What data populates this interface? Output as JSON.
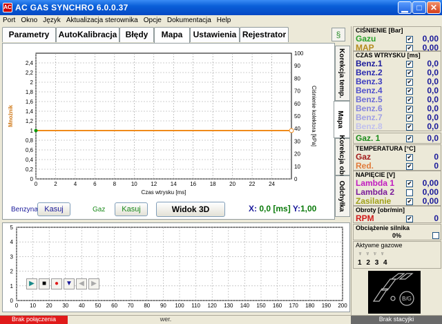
{
  "window": {
    "title": "AC GAS SYNCHRO  6.0.0.37"
  },
  "menu": [
    "Port",
    "Okno",
    "Język",
    "Aktualizacja sterownika",
    "Opcje",
    "Dokumentacja",
    "Help"
  ],
  "tabs": [
    "Parametry",
    "AutoKalibracja",
    "Błędy",
    "Mapa",
    "Ustawienia",
    "Rejestrator"
  ],
  "active_tab": "Mapa",
  "side_tabs": [
    "Korekcja temp.",
    "Mapa",
    "Korekcja obr.",
    "Odchyłka"
  ],
  "bottom": {
    "benzyna_label": "Benzyna",
    "kasuj1": "Kasuj",
    "gaz_label": "Gaz",
    "kasuj2": "Kasuj",
    "widok3d": "Widok 3D",
    "x_label": "X:",
    "x_value": "0,0 [ms]",
    "y_label": "Y:",
    "y_value": "1,00"
  },
  "chart_data": [
    {
      "type": "line",
      "xlabel": "Czas wtrysku [ms]",
      "ylabel": "Mnożnik",
      "y2label": "Ciśnienie kolektora [kPa]",
      "x_ticks": [
        "0",
        "2",
        "4",
        "6",
        "8",
        "10",
        "12",
        "14",
        "16",
        "18",
        "20",
        "22",
        "24"
      ],
      "y_ticks": [
        "0",
        "0,2",
        "0,4",
        "0,6",
        "0,8",
        "1",
        "1,2",
        "1,4",
        "1,6",
        "1,8",
        "2",
        "2,2",
        "2,4"
      ],
      "y2_ticks": [
        "0",
        "10",
        "20",
        "30",
        "40",
        "50",
        "60",
        "70",
        "80",
        "90",
        "100"
      ],
      "xlim": [
        0,
        26
      ],
      "ylim": [
        0,
        2.6
      ],
      "series": [
        {
          "x": [
            0,
            26
          ],
          "y": [
            1,
            1
          ]
        }
      ]
    },
    {
      "type": "line",
      "x_ticks": [
        "0",
        "10",
        "20",
        "30",
        "40",
        "50",
        "60",
        "70",
        "80",
        "90",
        "100",
        "110",
        "120",
        "130",
        "140",
        "150",
        "160",
        "170",
        "180",
        "190",
        "200"
      ],
      "y_ticks": [
        "0",
        "1",
        "2",
        "3",
        "4",
        "5"
      ],
      "xlim": [
        0,
        200
      ],
      "ylim": [
        0,
        5
      ]
    }
  ],
  "right": {
    "cisnienie": {
      "header": "CIŚNIENIE [Bar]",
      "rows": [
        {
          "name": "Gazu",
          "value": "0,00",
          "color": "#2aa02a",
          "checked": true
        },
        {
          "name": "MAP",
          "value": "0,00",
          "color": "#b38a1a",
          "checked": true
        }
      ]
    },
    "czas": {
      "header": "CZAS WTRYSKU  [ms]",
      "rows": [
        {
          "name": "Benz.1",
          "value": "0,0",
          "color": "#1a1a9a",
          "checked": true
        },
        {
          "name": "Benz.2",
          "value": "0,0",
          "color": "#2a2aae",
          "checked": true
        },
        {
          "name": "Benz.3",
          "value": "0,0",
          "color": "#3c3cc0",
          "checked": true
        },
        {
          "name": "Benz.4",
          "value": "0,0",
          "color": "#5050cc",
          "checked": true
        },
        {
          "name": "Benz.5",
          "value": "0,0",
          "color": "#6b6bd6",
          "checked": true
        },
        {
          "name": "Benz.6",
          "value": "0,0",
          "color": "#8585de",
          "checked": true
        },
        {
          "name": "Benz.7",
          "value": "0,0",
          "color": "#a0a0e6",
          "checked": true
        },
        {
          "name": "Benz.8",
          "value": "0,0",
          "color": "#c0c0ee",
          "checked": true
        }
      ]
    },
    "gaz1": {
      "name": "Gaz. 1",
      "value": "0,0",
      "color": "#1a8a1a",
      "checked": true
    },
    "temperatura": {
      "header": "TEMPERATURA  [°C]",
      "rows": [
        {
          "name": "Gaz",
          "value": "0",
          "color": "#a01a1a",
          "checked": true
        },
        {
          "name": "Red.",
          "value": "0",
          "color": "#e07a3a",
          "checked": true
        }
      ]
    },
    "napiecie": {
      "header": "NAPIĘCIE [V]",
      "rows": [
        {
          "name": "Lambda 1",
          "value": "0,00",
          "color": "#c01ac0",
          "checked": true
        },
        {
          "name": "Lambda 2",
          "value": "0,00",
          "color": "#7a1a9a",
          "checked": false
        },
        {
          "name": "Zasilanie",
          "value": "0,00",
          "color": "#a0a01a",
          "checked": true
        }
      ]
    },
    "obroty": {
      "header": "Obroty [obr/min]",
      "name": "RPM",
      "value": "0",
      "color": "#d01a1a",
      "checked": true
    },
    "obciazenie": {
      "header": "Obciążenie silnika",
      "value": "0%"
    },
    "aktywne": {
      "header": "Aktywne gazowe",
      "labels": [
        "1",
        "2",
        "3",
        "4"
      ]
    },
    "logo_text": "B/G"
  },
  "status": {
    "left": "Brak połączenia",
    "middle": "wer.",
    "right": "Brak stacyjki"
  }
}
